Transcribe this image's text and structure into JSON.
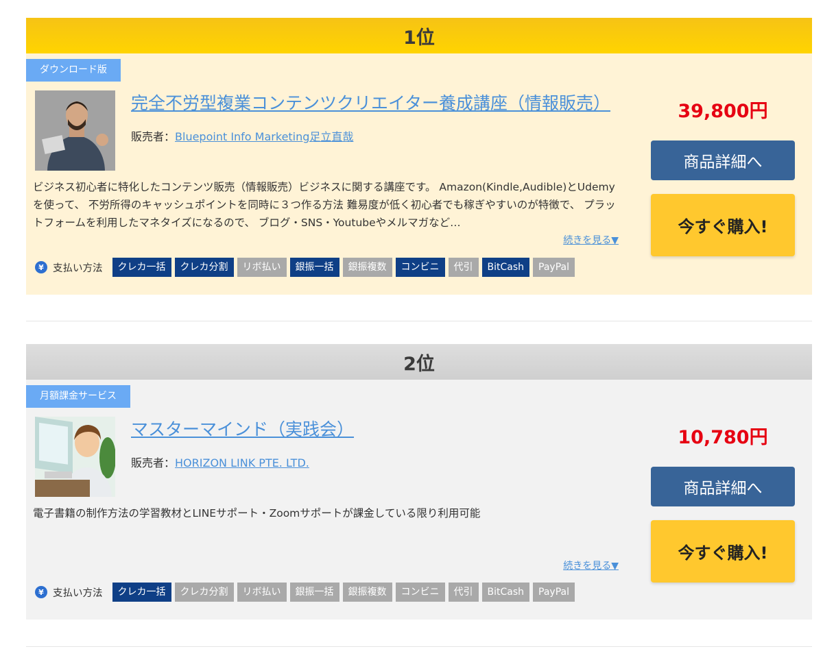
{
  "rankings": [
    {
      "rank_label": "1位",
      "type_badge": "ダウンロード版",
      "title": "完全不労型複業コンテンツクリエイター養成講座（情報販売）",
      "seller_prefix": "販売者：",
      "seller_name": "Bluepoint Info Marketing足立直哉",
      "description": "ビジネス初心者に特化したコンテンツ販売（情報販売）ビジネスに関する講座です。 Amazon(Kindle,Audible)とUdemyを使って、 不労所得のキャッシュポイントを同時に３つ作る方法 難易度が低く初心者でも稼ぎやすいのが特徴で、 プラットフォームを利用したマネタイズになるので、 ブログ・SNS・Youtubeやメルマガなど…",
      "more_label": "続きを見る▼",
      "payment_label": "支払い方法",
      "payment_methods": [
        {
          "label": "クレカ一括",
          "available": true
        },
        {
          "label": "クレカ分割",
          "available": true
        },
        {
          "label": "リボ払い",
          "available": false
        },
        {
          "label": "銀振一括",
          "available": true
        },
        {
          "label": "銀振複数",
          "available": false
        },
        {
          "label": "コンビニ",
          "available": true
        },
        {
          "label": "代引",
          "available": false
        },
        {
          "label": "BitCash",
          "available": true
        },
        {
          "label": "PayPal",
          "available": false
        }
      ],
      "price": "39,800円",
      "detail_button": "商品詳細へ",
      "buy_button": "今すぐ購入!"
    },
    {
      "rank_label": "2位",
      "type_badge": "月額課金サービス",
      "title": "マスターマインド（実践会）",
      "seller_prefix": "販売者：",
      "seller_name": "HORIZON LINK PTE. LTD.",
      "description": "電子書籍の制作方法の学習教材とLINEサポート・Zoomサポートが課金している限り利用可能",
      "more_label": "続きを見る▼",
      "payment_label": "支払い方法",
      "payment_methods": [
        {
          "label": "クレカ一括",
          "available": true
        },
        {
          "label": "クレカ分割",
          "available": false
        },
        {
          "label": "リボ払い",
          "available": false
        },
        {
          "label": "銀振一括",
          "available": false
        },
        {
          "label": "銀振複数",
          "available": false
        },
        {
          "label": "コンビニ",
          "available": false
        },
        {
          "label": "代引",
          "available": false
        },
        {
          "label": "BitCash",
          "available": false
        },
        {
          "label": "PayPal",
          "available": false
        }
      ],
      "price": "10,780円",
      "detail_button": "商品詳細へ",
      "buy_button": "今すぐ購入!"
    }
  ],
  "colors": {
    "gold_header": "#ffd400",
    "silver_header": "#d6d6d6",
    "price": "#e60012",
    "detail_button": "#386498",
    "buy_button": "#ffc82e",
    "tag_available": "#0f3f86",
    "tag_unavailable": "#a9a9a9",
    "badge": "#6aaaf4",
    "link": "#4a90d9"
  }
}
